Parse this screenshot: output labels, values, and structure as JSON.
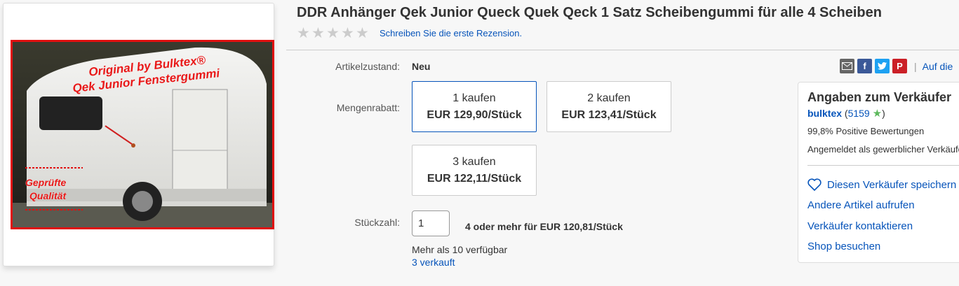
{
  "product": {
    "title": "DDR Anhänger Qek Junior Queck Quek Qeck 1 Satz Scheibengummi für alle 4 Scheiben",
    "review_link": "Schreiben Sie die erste Rezension.",
    "image_watermark": {
      "line1": "Original by Bulktex®",
      "line2": "Qek Junior Fenstergummi",
      "line3": "Geprüfte",
      "line4": "Qualität"
    }
  },
  "details": {
    "condition_label": "Artikelzustand:",
    "condition_value": "Neu",
    "discount_label": "Mengenrabatt:",
    "tiers": [
      {
        "qty": "1 kaufen",
        "price": "EUR 129,90/Stück"
      },
      {
        "qty": "2 kaufen",
        "price": "EUR 123,41/Stück"
      },
      {
        "qty": "3 kaufen",
        "price": "EUR 122,11/Stück"
      }
    ],
    "quantity_label": "Stückzahl:",
    "quantity_value": "1",
    "bulk_note": "4 oder mehr für EUR 120,81/Stück",
    "available": "Mehr als 10 verfügbar",
    "sold": "3 verkauft"
  },
  "share": {
    "pipe": "|",
    "watch_label": "Auf die"
  },
  "seller": {
    "title": "Angaben zum Verkäufer",
    "name": "bulktex",
    "score_open": "(",
    "score": "5159",
    "score_close": ")",
    "positive": "99,8% Positive Bewertungen",
    "registered": "Angemeldet als gewerblicher Verkäufer",
    "save": "Diesen Verkäufer speichern",
    "other_items": "Andere Artikel aufrufen",
    "contact": "Verkäufer kontaktieren",
    "shop": "Shop besuchen"
  },
  "colors": {
    "link": "#0654ba",
    "selected_border": "#0654ba",
    "watermark_red": "#e01010"
  }
}
